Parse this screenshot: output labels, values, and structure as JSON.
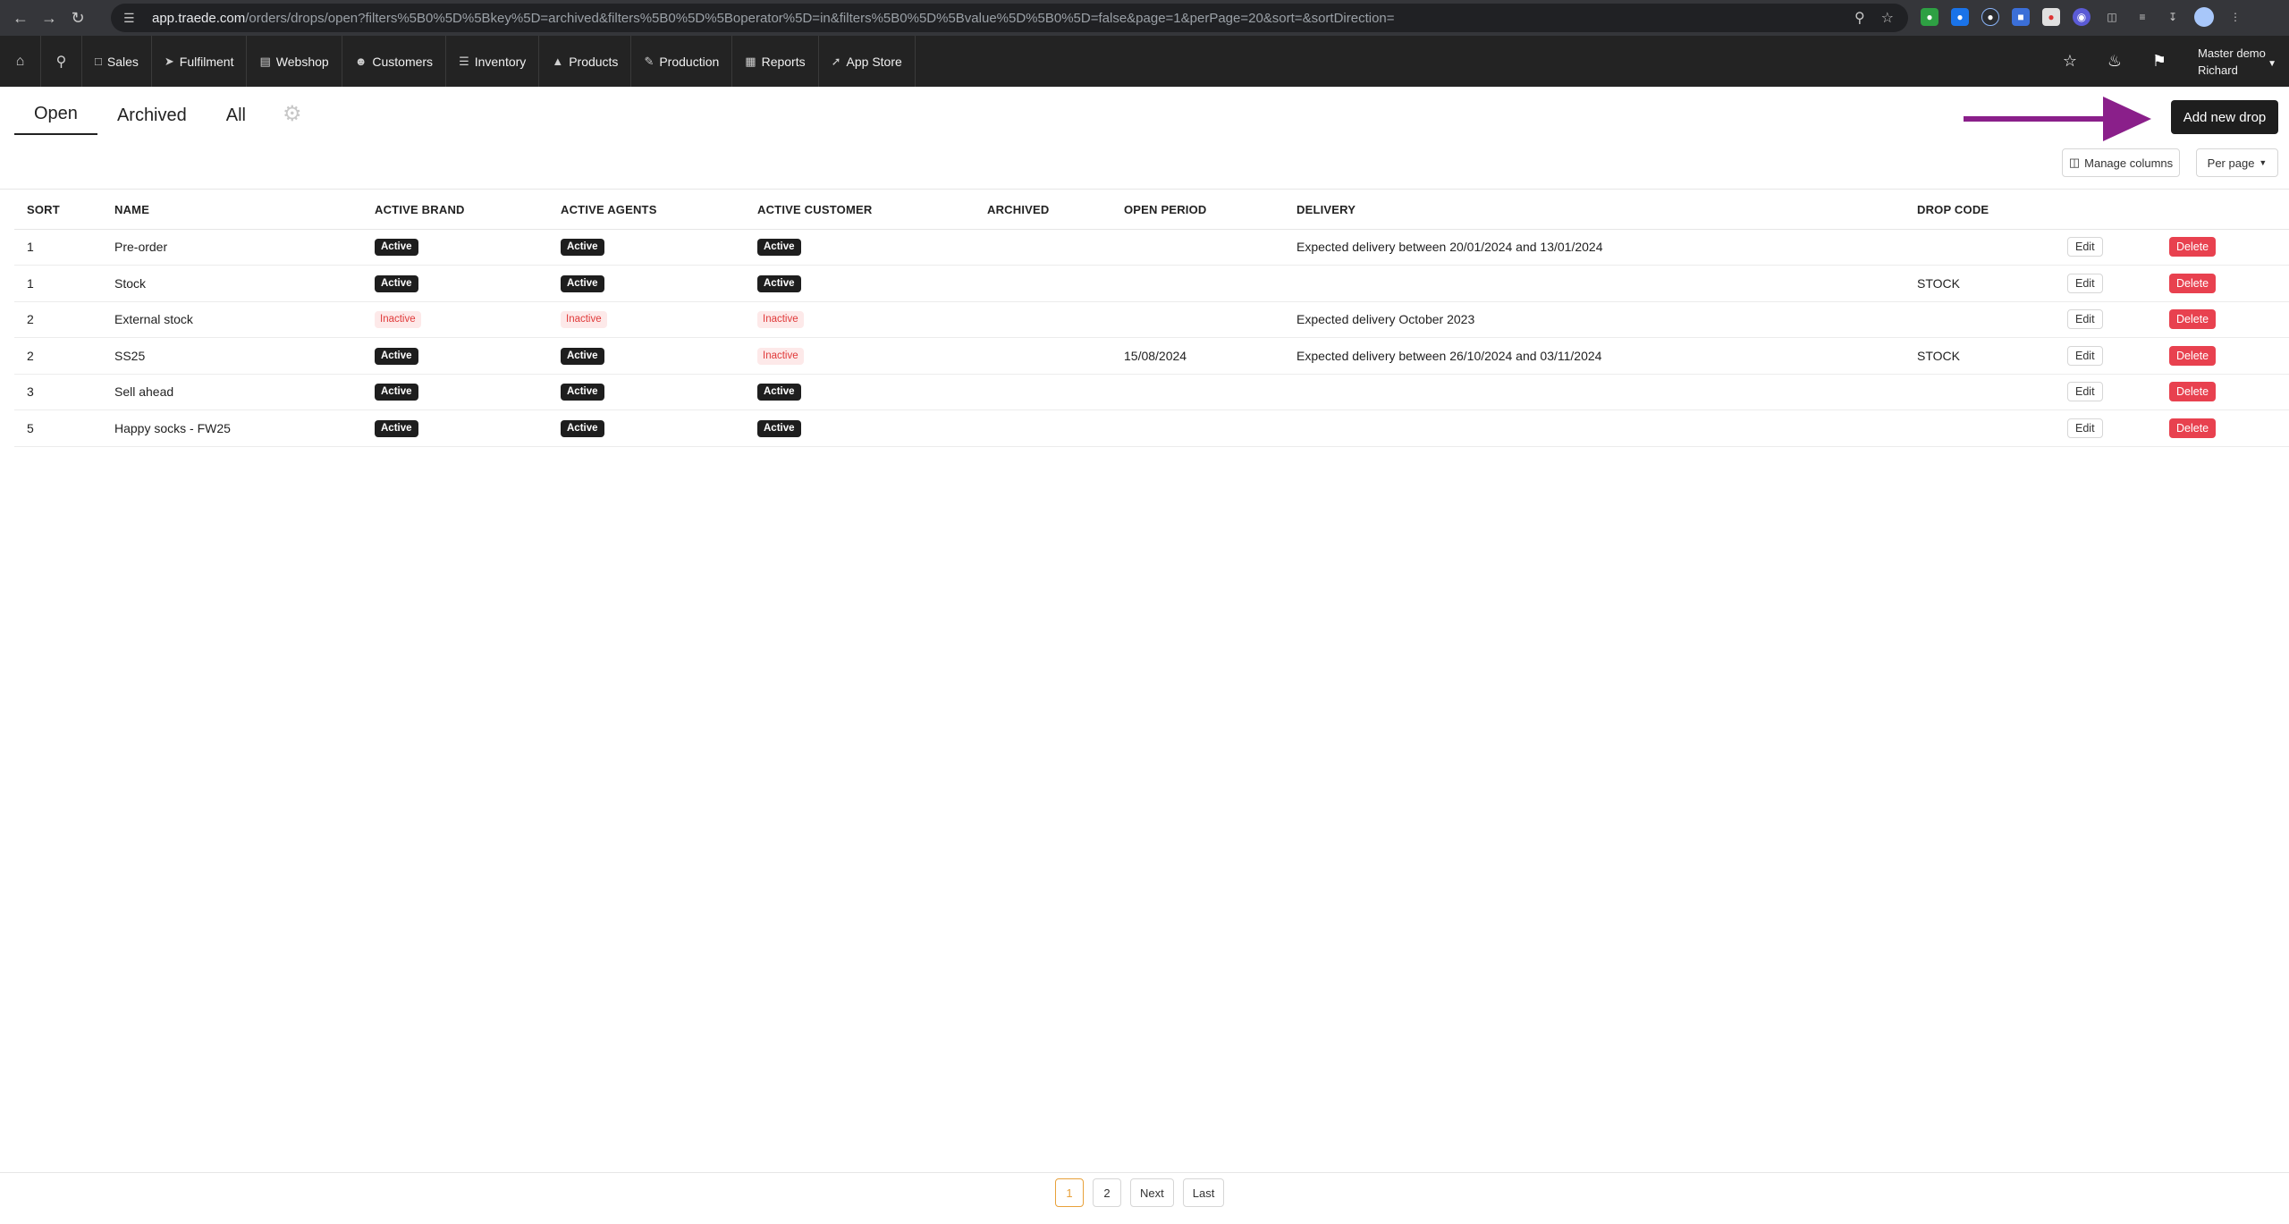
{
  "browser": {
    "url_host": "app.traede.com",
    "url_path": "/orders/drops/open?filters%5B0%5D%5Bkey%5D=archived&filters%5B0%5D%5Boperator%5D=in&filters%5B0%5D%5Bvalue%5D%5B0%5D=false&page=1&perPage=20&sort=&sortDirection="
  },
  "nav": {
    "items": [
      {
        "label": "Sales",
        "icon": "document-icon"
      },
      {
        "label": "Fulfilment",
        "icon": "send-icon"
      },
      {
        "label": "Webshop",
        "icon": "cart-icon"
      },
      {
        "label": "Customers",
        "icon": "users-icon"
      },
      {
        "label": "Inventory",
        "icon": "layers-icon"
      },
      {
        "label": "Products",
        "icon": "shirt-icon"
      },
      {
        "label": "Production",
        "icon": "pen-icon"
      },
      {
        "label": "Reports",
        "icon": "chart-icon"
      },
      {
        "label": "App Store",
        "icon": "rocket-icon"
      }
    ],
    "user_line1": "Master demo",
    "user_line2": "Richard"
  },
  "tabs": {
    "open": "Open",
    "archived": "Archived",
    "all": "All"
  },
  "actions": {
    "add_new_drop": "Add new drop",
    "manage_columns": "Manage columns",
    "per_page": "Per page"
  },
  "table": {
    "headers": {
      "sort": "SORT",
      "name": "NAME",
      "active_brand": "ACTIVE BRAND",
      "active_agents": "ACTIVE AGENTS",
      "active_customer": "ACTIVE CUSTOMER",
      "archived": "ARCHIVED",
      "open_period": "OPEN PERIOD",
      "delivery": "DELIVERY",
      "drop_code": "DROP CODE"
    },
    "edit_label": "Edit",
    "delete_label": "Delete",
    "rows": [
      {
        "sort": "1",
        "name": "Pre-order",
        "brand": "Active",
        "agents": "Active",
        "customer": "Active",
        "archived": "",
        "open_period": "",
        "delivery": "Expected delivery between 20/01/2024 and 13/01/2024",
        "drop_code": ""
      },
      {
        "sort": "1",
        "name": "Stock",
        "brand": "Active",
        "agents": "Active",
        "customer": "Active",
        "archived": "",
        "open_period": "",
        "delivery": "",
        "drop_code": "STOCK"
      },
      {
        "sort": "2",
        "name": "External stock",
        "brand": "Inactive",
        "agents": "Inactive",
        "customer": "Inactive",
        "archived": "",
        "open_period": "",
        "delivery": "Expected delivery October 2023",
        "drop_code": ""
      },
      {
        "sort": "2",
        "name": "SS25",
        "brand": "Active",
        "agents": "Active",
        "customer": "Inactive",
        "archived": "",
        "open_period": "15/08/2024",
        "delivery": "Expected delivery between 26/10/2024 and 03/11/2024",
        "drop_code": "STOCK"
      },
      {
        "sort": "3",
        "name": "Sell ahead",
        "brand": "Active",
        "agents": "Active",
        "customer": "Active",
        "archived": "",
        "open_period": "",
        "delivery": "",
        "drop_code": ""
      },
      {
        "sort": "5",
        "name": "Happy socks - FW25",
        "brand": "Active",
        "agents": "Active",
        "customer": "Active",
        "archived": "",
        "open_period": "",
        "delivery": "",
        "drop_code": ""
      }
    ]
  },
  "pagination": {
    "pages": [
      "1",
      "2"
    ],
    "current": "1",
    "next": "Next",
    "last": "Last"
  },
  "colors": {
    "nav_bg": "#232323",
    "active_badge": "#1e1e1e",
    "inactive_badge_text": "#e03a3a",
    "delete_button": "#e8414f",
    "arrow": "#8a1f8a",
    "current_page": "#e8a13a"
  }
}
